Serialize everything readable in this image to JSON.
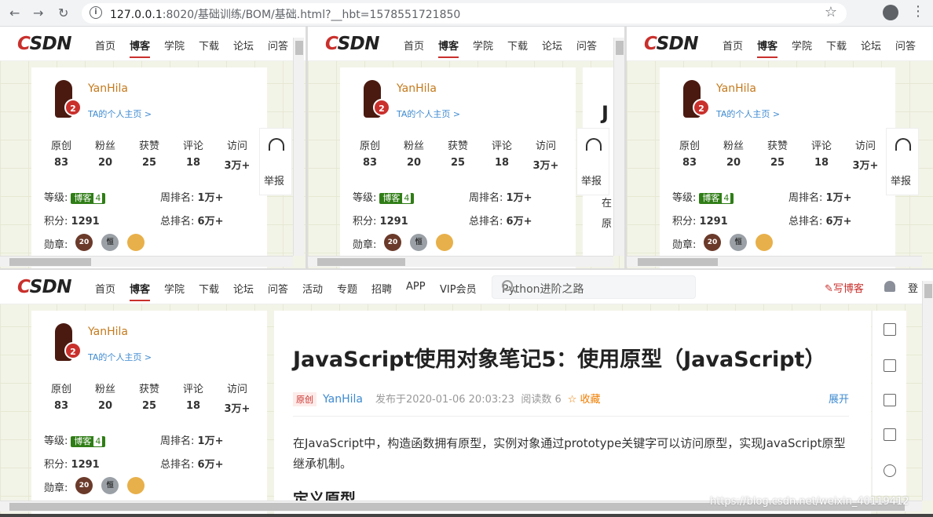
{
  "browser": {
    "url_host": "127.0.0.1",
    "url_rest": ":8020/基础训练/BOM/基础.html?__hbt=1578551721850"
  },
  "site": {
    "logo": "CSDN",
    "nav": [
      "首页",
      "博客",
      "学院",
      "下载",
      "论坛",
      "问答",
      "活动",
      "专题",
      "招聘",
      "APP",
      "VIP会员"
    ],
    "search_placeholder": "Python进阶之路",
    "write": "写博客",
    "login": "登"
  },
  "profile": {
    "avatar_badge": "2",
    "username": "YanHila",
    "home_link": "TA的个人主页 >",
    "stats": [
      {
        "label": "原创",
        "value": "83"
      },
      {
        "label": "粉丝",
        "value": "20"
      },
      {
        "label": "获赞",
        "value": "25"
      },
      {
        "label": "评论",
        "value": "18"
      },
      {
        "label": "访问",
        "value": "3万+"
      }
    ],
    "level_label": "等级:",
    "level_badge": "博客",
    "level_num": "4",
    "weekly_label": "周排名:",
    "weekly_value": "1万+",
    "points_label": "积分:",
    "points_value": "1291",
    "total_label": "总排名:",
    "total_value": "6万+",
    "medals_label": "勋章:",
    "medals": [
      "20",
      "恒",
      ""
    ]
  },
  "float_panel": {
    "report": "举报"
  },
  "article": {
    "title": "JavaScript使用对象笔记5：使用原型（JavaScript）",
    "type": "原创",
    "author": "YanHila",
    "published": "发布于2020-01-06 20:03:23",
    "reads": "阅读数 6",
    "favorite": "☆ 收藏",
    "expand": "展开",
    "intro": "在JavaScript中，构造函数拥有原型，实例对象通过prototype关键字可以访问原型，实现JavaScript原型继承机制。",
    "heading": "定义原型"
  },
  "partial": {
    "b_title_fragment": "J",
    "b_line1": "在",
    "b_line2": "原"
  },
  "watermark": "https://blog.csdn.net/weixin_40119412"
}
